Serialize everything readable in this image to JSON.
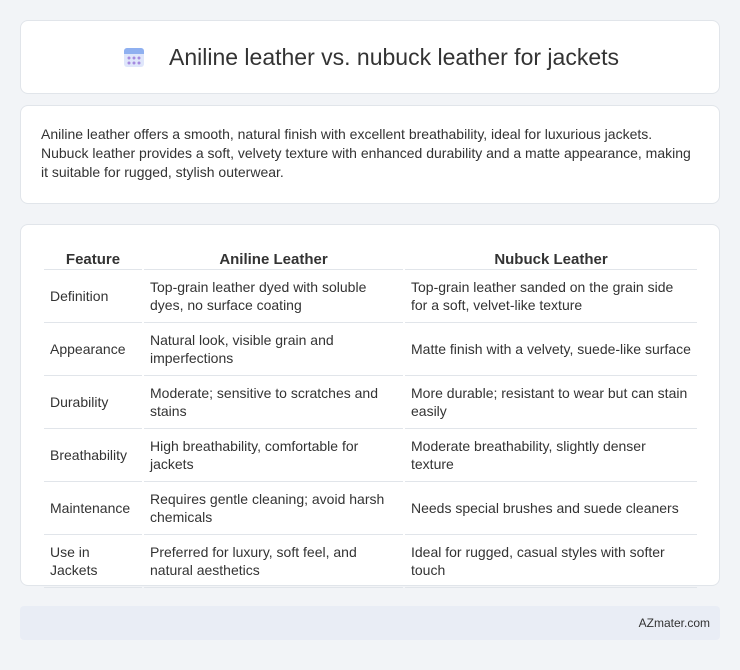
{
  "header": {
    "title": "Aniline leather vs. nubuck leather for jackets",
    "icon": "calendar-icon"
  },
  "intro": {
    "text": "Aniline leather offers a smooth, natural finish with excellent breathability, ideal for luxurious jackets. Nubuck leather provides a soft, velvety texture with enhanced durability and a matte appearance, making it suitable for rugged, stylish outerwear."
  },
  "table": {
    "headers": [
      "Feature",
      "Aniline Leather",
      "Nubuck Leather"
    ],
    "rows": [
      [
        "Definition",
        "Top-grain leather dyed with soluble dyes, no surface coating",
        "Top-grain leather sanded on the grain side for a soft, velvet-like texture"
      ],
      [
        "Appearance",
        "Natural look, visible grain and imperfections",
        "Matte finish with a velvety, suede-like surface"
      ],
      [
        "Durability",
        "Moderate; sensitive to scratches and stains",
        "More durable; resistant to wear but can stain easily"
      ],
      [
        "Breathability",
        "High breathability, comfortable for jackets",
        "Moderate breathability, slightly denser texture"
      ],
      [
        "Maintenance",
        "Requires gentle cleaning; avoid harsh chemicals",
        "Needs special brushes and suede cleaners"
      ],
      [
        "Use in Jackets",
        "Preferred for luxury, soft feel, and natural aesthetics",
        "Ideal for rugged, casual styles with softer touch"
      ]
    ]
  },
  "footer": {
    "text": "AZmater.com"
  },
  "colors": {
    "background": "#f2f4f7",
    "card": "#ffffff",
    "footer": "#e9edf5",
    "icon_purple": "#8b7fd6",
    "icon_blue": "#b8c8f0"
  }
}
